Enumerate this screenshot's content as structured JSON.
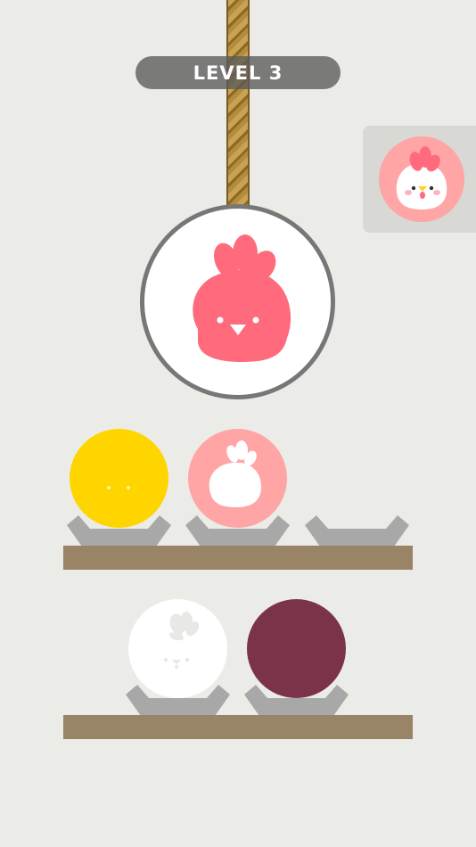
{
  "level": {
    "label": "LEVEL 3"
  },
  "colors": {
    "background": "#ebebe7",
    "rope": "#b48c3c",
    "shelf": "#9a8468",
    "holder": "#a8a8a8",
    "target_ball": "#ffa5a5",
    "chicken_red": "#ff6b7d",
    "yellow_ball": "#ffd500",
    "pink_ball": "#ffa5a5",
    "white_ball": "#ffffff",
    "maroon_ball": "#7a3348"
  },
  "hanging_ball": {
    "fill": "white",
    "icon": "chicken-icon"
  },
  "target": {
    "fill": "pink",
    "icon": "chicken-face-icon"
  },
  "shelves": [
    {
      "slots": [
        {
          "ball": "yellow",
          "pattern": "dots-face"
        },
        {
          "ball": "pink",
          "pattern": "chicken-silhouette"
        },
        {
          "ball": null
        }
      ]
    },
    {
      "slots": [
        {
          "ball": "white",
          "pattern": "chicken-comb-face"
        },
        {
          "ball": "maroon",
          "pattern": "plain"
        }
      ]
    }
  ]
}
